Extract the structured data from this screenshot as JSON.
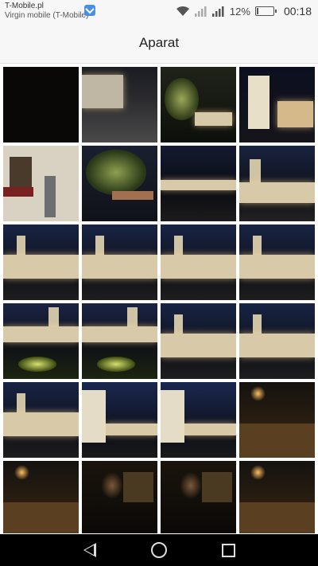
{
  "status_bar": {
    "carrier_line1": "T-Mobile.pl",
    "carrier_line2": "Virgin mobile (T-Mobile)",
    "battery_percent": "12%",
    "battery_level": 0.12,
    "time": "00:18"
  },
  "header": {
    "title": "Aparat"
  },
  "thumbnails": [
    {
      "scene": "dark"
    },
    {
      "scene": "street-wall"
    },
    {
      "scene": "trees-lit"
    },
    {
      "scene": "tower-church"
    },
    {
      "scene": "window-facade"
    },
    {
      "scene": "tree-night"
    },
    {
      "scene": "palace-far"
    },
    {
      "scene": "palace-tower"
    },
    {
      "scene": "palace-wide"
    },
    {
      "scene": "palace-wide"
    },
    {
      "scene": "palace-wide"
    },
    {
      "scene": "palace-wide"
    },
    {
      "scene": "palace-lawn"
    },
    {
      "scene": "palace-lawn"
    },
    {
      "scene": "palace-wide"
    },
    {
      "scene": "palace-wide"
    },
    {
      "scene": "palace-wide"
    },
    {
      "scene": "tower-close"
    },
    {
      "scene": "tower-close"
    },
    {
      "scene": "street-orange"
    },
    {
      "scene": "street-orange"
    },
    {
      "scene": "car-interior"
    },
    {
      "scene": "car-interior"
    },
    {
      "scene": "street-orange"
    }
  ],
  "nav": {
    "back": "back-icon",
    "home": "home-icon",
    "recent": "recent-apps-icon"
  }
}
